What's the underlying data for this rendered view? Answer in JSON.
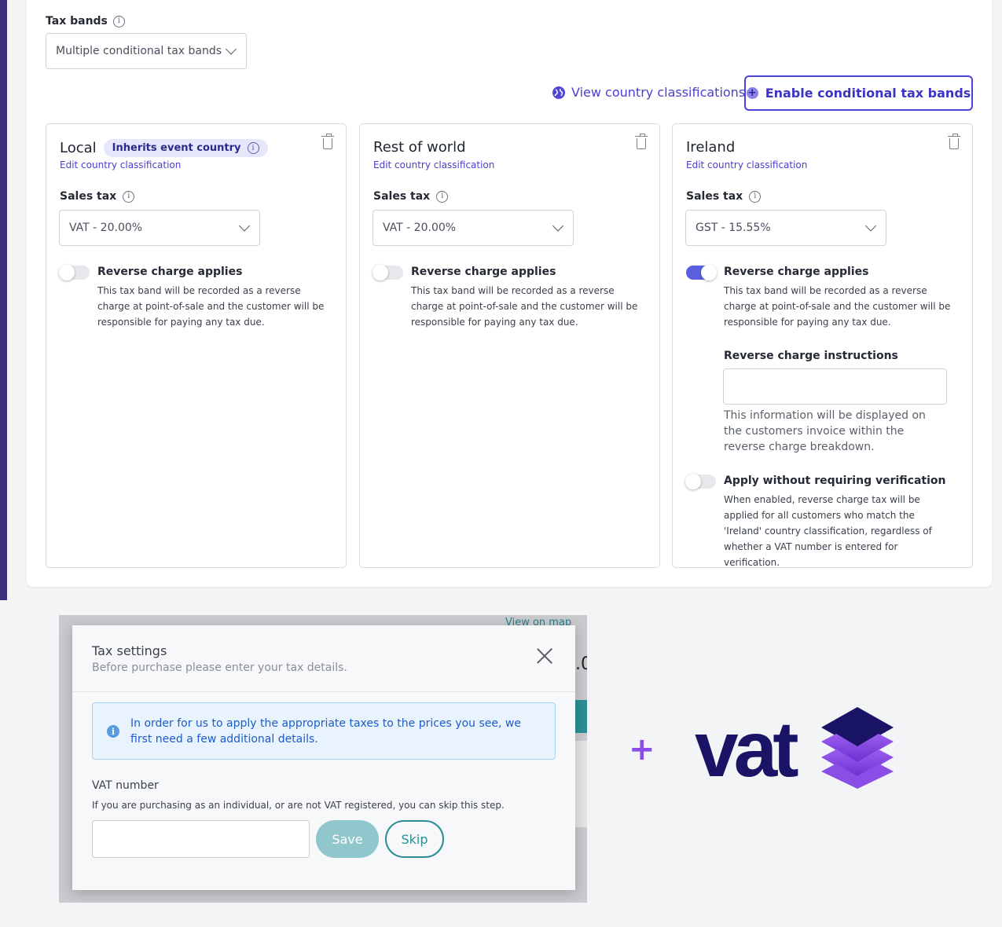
{
  "tax_bands": {
    "label": "Tax bands",
    "select_value": "Multiple conditional tax bands"
  },
  "actions": {
    "view_classifications": "View country classifications",
    "enable_conditional": "Enable conditional tax bands"
  },
  "bands": [
    {
      "title": "Local",
      "chip": "Inherits event country",
      "edit_link": "Edit country classification",
      "sales_tax_label": "Sales tax",
      "sales_tax_value": "VAT - 20.00%",
      "reverse_charge_on": false,
      "reverse_charge_title": "Reverse charge applies",
      "reverse_charge_desc": "This tax band will be recorded as a reverse charge at point-of-sale and the customer will be responsible for paying any tax due."
    },
    {
      "title": "Rest of world",
      "edit_link": "Edit country classification",
      "sales_tax_label": "Sales tax",
      "sales_tax_value": "VAT - 20.00%",
      "reverse_charge_on": false,
      "reverse_charge_title": "Reverse charge applies",
      "reverse_charge_desc": "This tax band will be recorded as a reverse charge at point-of-sale and the customer will be responsible for paying any tax due."
    },
    {
      "title": "Ireland",
      "edit_link": "Edit country classification",
      "sales_tax_label": "Sales tax",
      "sales_tax_value": "GST - 15.55%",
      "reverse_charge_on": true,
      "reverse_charge_title": "Reverse charge applies",
      "reverse_charge_desc": "This tax band will be recorded as a reverse charge at point-of-sale and the customer will be responsible for paying any tax due.",
      "instructions_label": "Reverse charge instructions",
      "instructions_value": "",
      "instructions_help": "This information will be displayed on the customers invoice within the reverse charge breakdown.",
      "apply_without_verification_on": false,
      "apply_title": "Apply without requiring verification",
      "apply_desc": "When enabled, reverse charge tax will be applied for all customers who match the 'Ireland' country classification, regardless of whether a VAT number is entered for verification."
    }
  ],
  "modal": {
    "background_link": "View on map",
    "background_fragment": ".0",
    "title": "Tax settings",
    "subtitle": "Before purchase please enter your tax details.",
    "alert": "In order for us to apply the appropriate taxes to the prices you see, we first need a few additional details.",
    "vat_label": "VAT number",
    "vat_help": "If you are purchasing as an individual, or are not VAT registered, you can skip this step.",
    "vat_value": "",
    "save_label": "Save",
    "skip_label": "Skip"
  },
  "logo": {
    "plus": "+",
    "text": "vat"
  },
  "colors": {
    "accent": "#4b42d6",
    "teal": "#2b8e96",
    "logo_navy": "#1a1466",
    "logo_purple": "#8a4de6"
  }
}
